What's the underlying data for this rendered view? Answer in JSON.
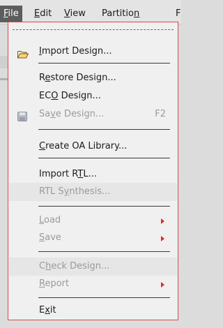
{
  "menubar": {
    "items": [
      {
        "pre": "",
        "u": "F",
        "post": "ile"
      },
      {
        "pre": "",
        "u": "E",
        "post": "dit"
      },
      {
        "pre": "",
        "u": "V",
        "post": "iew"
      },
      {
        "pre": "Partitio",
        "u": "n",
        "post": ""
      },
      {
        "pre": "F",
        "u": "",
        "post": ""
      }
    ]
  },
  "file_menu": {
    "import_design": {
      "pre": "",
      "u": "I",
      "post": "mport Design..."
    },
    "restore_design": {
      "pre": "R",
      "u": "e",
      "post": "store Design..."
    },
    "eco_design": {
      "pre": "EC",
      "u": "O",
      "post": " Design..."
    },
    "save_design": {
      "pre": "Sa",
      "u": "v",
      "post": "e Design...",
      "shortcut": "F2"
    },
    "create_oa_library": {
      "pre": "",
      "u": "C",
      "post": "reate OA Library..."
    },
    "import_rtl": {
      "pre": "Import R",
      "u": "T",
      "post": "L..."
    },
    "rtl_synthesis": {
      "pre": "RTL S",
      "u": "y",
      "post": "nthesis..."
    },
    "load": {
      "pre": "",
      "u": "L",
      "post": "oad"
    },
    "save": {
      "pre": "",
      "u": "S",
      "post": "ave"
    },
    "check_design": {
      "pre": "C",
      "u": "h",
      "post": "eck Design..."
    },
    "report": {
      "pre": "",
      "u": "R",
      "post": "eport"
    },
    "exit": {
      "pre": "E",
      "u": "x",
      "post": "it"
    }
  },
  "colors": {
    "accent": "#e02a2a",
    "menubar_active": "#5d5d5d",
    "disabled_text": "#9a9a9a"
  },
  "icons": {
    "import_design": "folder-open-icon",
    "save_design": "floppy-disk-icon",
    "submenu": "submenu-arrow-icon"
  }
}
